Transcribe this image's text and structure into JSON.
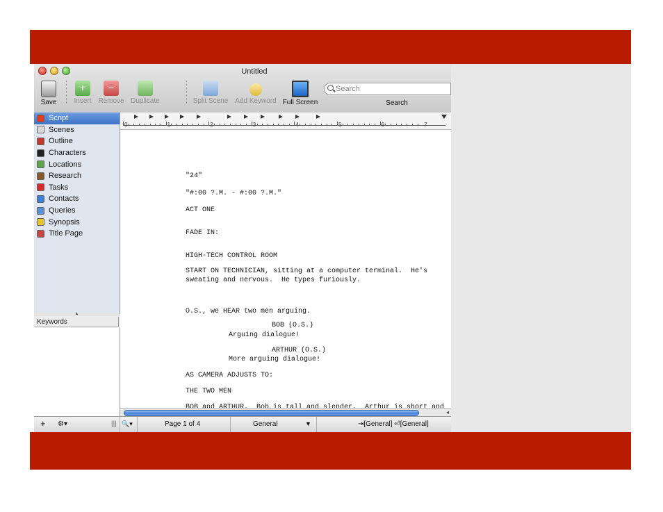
{
  "window": {
    "title": "Untitled"
  },
  "toolbar": {
    "save": "Save",
    "insert": "Insert",
    "remove": "Remove",
    "duplicate": "Duplicate",
    "split_scene": "Split Scene",
    "add_keyword": "Add Keyword",
    "full_screen": "Full Screen",
    "search_placeholder": "Search",
    "search_label": "Search"
  },
  "sidebar": {
    "items": [
      {
        "label": "Script",
        "icon": "script-icon",
        "color": "#e23c1e"
      },
      {
        "label": "Scenes",
        "icon": "scenes-icon",
        "color": "#d9d9d9"
      },
      {
        "label": "Outline",
        "icon": "outline-icon",
        "color": "#c0392b"
      },
      {
        "label": "Characters",
        "icon": "characters-icon",
        "color": "#222222"
      },
      {
        "label": "Locations",
        "icon": "locations-icon",
        "color": "#5fa34a"
      },
      {
        "label": "Research",
        "icon": "research-icon",
        "color": "#8a5a2b"
      },
      {
        "label": "Tasks",
        "icon": "tasks-icon",
        "color": "#d62b2b"
      },
      {
        "label": "Contacts",
        "icon": "contacts-icon",
        "color": "#3d7fd6"
      },
      {
        "label": "Queries",
        "icon": "queries-icon",
        "color": "#5a8fd8"
      },
      {
        "label": "Synopsis",
        "icon": "synopsis-icon",
        "color": "#e8c32a"
      },
      {
        "label": "Title Page",
        "icon": "title-page-icon",
        "color": "#c94444"
      }
    ],
    "keywords_header": "Keywords"
  },
  "ruler": {
    "numbers": [
      "0",
      "1",
      "2",
      "3",
      "4",
      "5",
      "6",
      "7"
    ]
  },
  "script": {
    "lines": [
      "\"24\"",
      "\"#:00 ?.M. - #:00 ?.M.\"",
      "ACT ONE",
      "FADE IN:",
      "HIGH-TECH CONTROL ROOM",
      "START ON TECHNICIAN, sitting at a computer terminal.  He's",
      "sweating and nervous.  He types furiously.",
      "O.S., we HEAR two men arguing.",
      "BOB (O.S.)",
      "Arguing dialogue!",
      "ARTHUR (O.S.)",
      "More arguing dialogue!",
      "AS CAMERA ADJUSTS TO:",
      "THE TWO MEN",
      "BOB and ARTHUR.  Bob is tall and slender.  Arthur is short and"
    ]
  },
  "statusbar": {
    "add": "+",
    "gear": "⚙▾",
    "columns": "|||",
    "zoom": "🔍▾",
    "page": "Page 1 of 4",
    "style": "General",
    "style_arrow": "▼",
    "next_style": "⇥[General] ⏎[General]"
  },
  "colors": {
    "band": "#b71c00",
    "selection": "#3d73c8"
  }
}
